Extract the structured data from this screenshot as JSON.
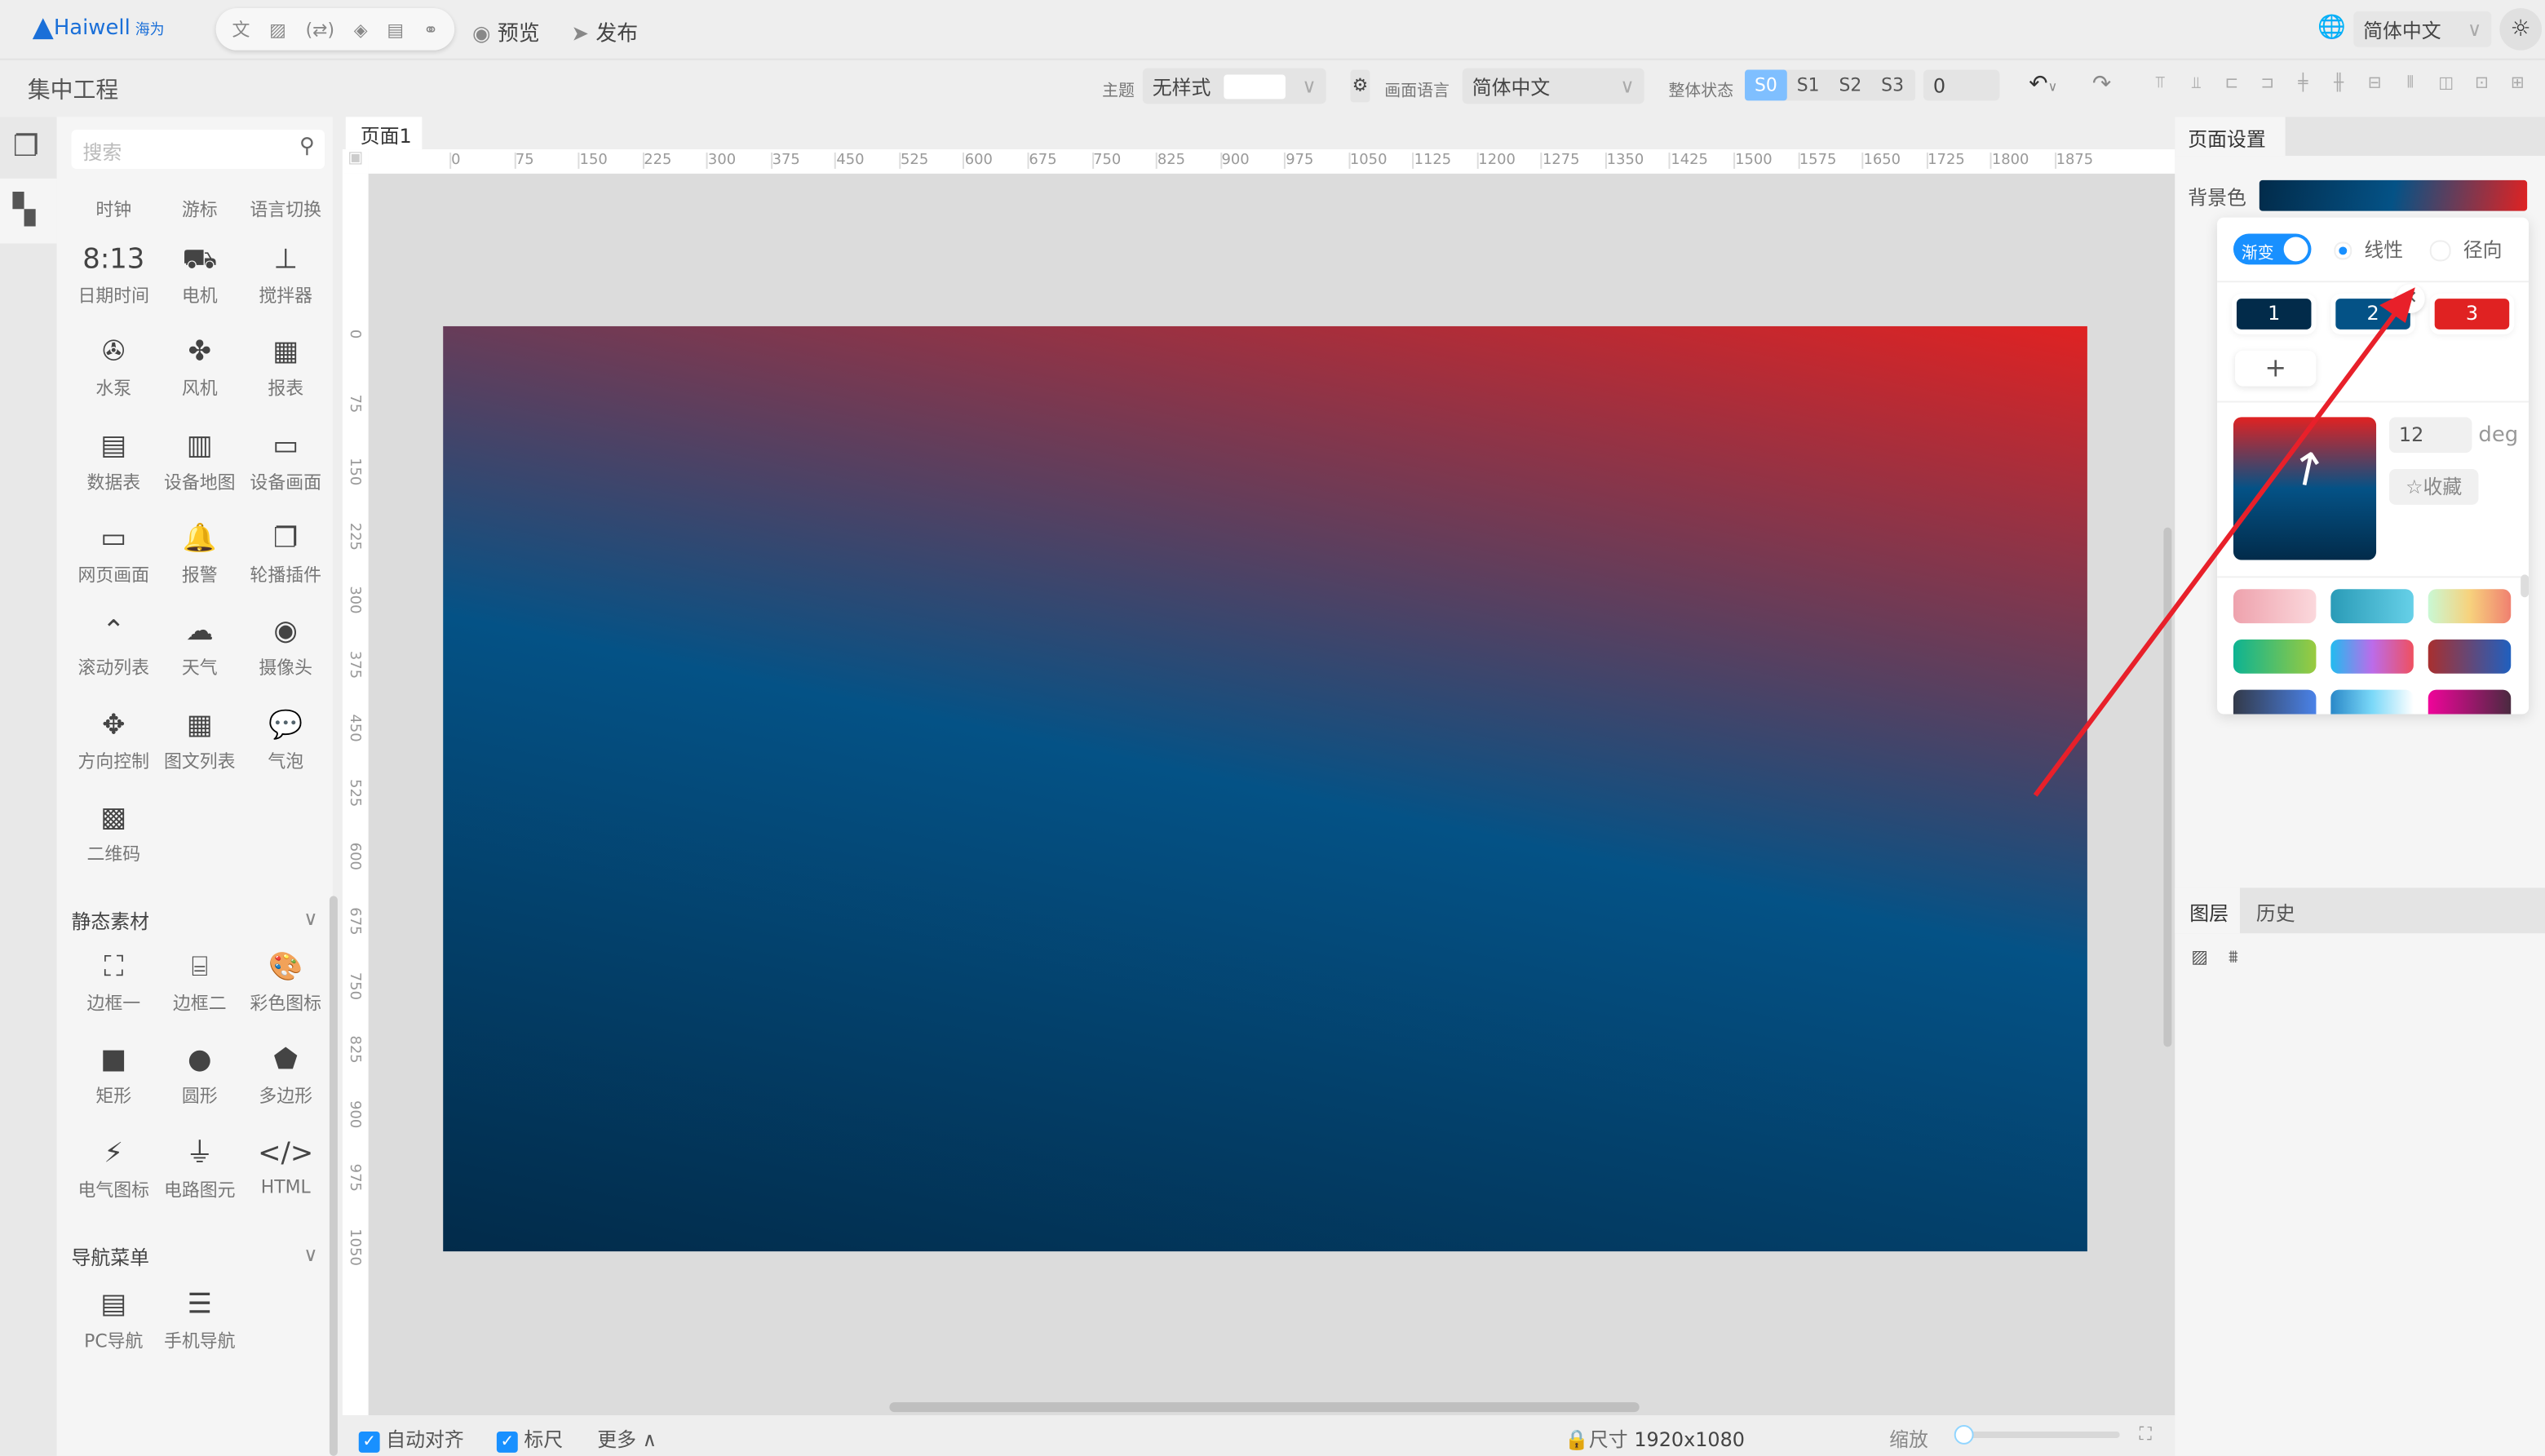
{
  "app": {
    "logo_text": "Haiwell",
    "logo_cn": "海为",
    "preview": "预览",
    "publish": "发布",
    "language": "简体中文",
    "toolbar_icons": [
      "translate-icon",
      "image-icon",
      "variable-icon",
      "layers-icon",
      "document-icon",
      "link-icon"
    ]
  },
  "project": {
    "title": "集中工程"
  },
  "controls": {
    "theme_label": "主题",
    "theme_value": "无样式",
    "lang_label": "画面语言",
    "lang_value": "简体中文",
    "state_label": "整体状态",
    "states": [
      "S0",
      "S1",
      "S2",
      "S3"
    ],
    "active_state": "S0",
    "state_input": "0"
  },
  "left": {
    "search_placeholder": "搜索",
    "tabs": [
      "时钟",
      "游标",
      "语言切换"
    ],
    "components": [
      {
        "icon": "8:13",
        "label": "日期时间"
      },
      {
        "icon": "⛟",
        "label": "电机"
      },
      {
        "icon": "⊥",
        "label": "搅拌器"
      },
      {
        "icon": "✇",
        "label": "水泵"
      },
      {
        "icon": "✤",
        "label": "风机"
      },
      {
        "icon": "▦",
        "label": "报表"
      },
      {
        "icon": "▤",
        "label": "数据表"
      },
      {
        "icon": "▥",
        "label": "设备地图"
      },
      {
        "icon": "▭",
        "label": "设备画面"
      },
      {
        "icon": "▭",
        "label": "网页画面"
      },
      {
        "icon": "🔔",
        "label": "报警"
      },
      {
        "icon": "❐",
        "label": "轮播插件"
      },
      {
        "icon": "⌃",
        "label": "滚动列表"
      },
      {
        "icon": "☁",
        "label": "天气"
      },
      {
        "icon": "◉",
        "label": "摄像头"
      },
      {
        "icon": "✥",
        "label": "方向控制"
      },
      {
        "icon": "▦",
        "label": "图文列表"
      },
      {
        "icon": "💬",
        "label": "气泡"
      },
      {
        "icon": "▩",
        "label": "二维码"
      }
    ],
    "static_section": "静态素材",
    "static": [
      {
        "icon": "⛶",
        "label": "边框一"
      },
      {
        "icon": "⌸",
        "label": "边框二"
      },
      {
        "icon": "🎨",
        "label": "彩色图标"
      },
      {
        "icon": "■",
        "label": "矩形"
      },
      {
        "icon": "●",
        "label": "圆形"
      },
      {
        "icon": "⬟",
        "label": "多边形"
      },
      {
        "icon": "⚡",
        "label": "电气图标"
      },
      {
        "icon": "⏚",
        "label": "电路图元"
      },
      {
        "icon": "</>",
        "label": "HTML"
      }
    ],
    "nav_section": "导航菜单",
    "nav": [
      {
        "icon": "▤",
        "label": "PC导航"
      },
      {
        "icon": "☰",
        "label": "手机导航"
      }
    ]
  },
  "canvas": {
    "page_tab": "页面1",
    "h_ticks": [
      "0",
      "75",
      "150",
      "225",
      "300",
      "375",
      "450",
      "525",
      "600",
      "675",
      "750",
      "825",
      "900",
      "975",
      "1050",
      "1125",
      "1200",
      "1275",
      "1350",
      "1425",
      "1500",
      "1575",
      "1650",
      "1725",
      "1800",
      "1875"
    ],
    "v_ticks": [
      "0",
      "75",
      "150",
      "225",
      "300",
      "375",
      "450",
      "525",
      "600",
      "675",
      "750",
      "825",
      "900",
      "975",
      "1050"
    ]
  },
  "bottom": {
    "auto_align": "自动对齐",
    "ruler": "标尺",
    "more": "更多",
    "size_label": "尺寸",
    "size_value": "1920x1080",
    "zoom_label": "缩放",
    "zoom_value": 0
  },
  "right": {
    "tab": "页面设置",
    "bg_label": "背景色",
    "gradient_toggle": "渐变",
    "gradient_on": true,
    "linear": "线性",
    "radial": "径向",
    "type_selected": "线性",
    "stops": [
      {
        "label": "1",
        "color": "#022b4a"
      },
      {
        "label": "2",
        "color": "#045286"
      },
      {
        "label": "3",
        "color": "#e02222"
      }
    ],
    "angle": "12",
    "angle_unit": "deg",
    "favorite": "收藏",
    "presets": [
      [
        "#eea2ad",
        "#fbd8dc"
      ],
      [
        "#2a9bb7",
        "#66d0e8"
      ],
      [
        "#c9f8d4",
        "#f7d27d",
        "#f08070"
      ],
      [
        "#0db392",
        "#9acb3f"
      ],
      [
        "#22bbef",
        "#bb6cea",
        "#ef5060"
      ],
      [
        "#a82f2f",
        "#2060bf"
      ],
      [
        "#333a4a",
        "#4a82e8"
      ],
      [
        "#2a88c8",
        "#7ad8f8",
        "#ffffff"
      ],
      [
        "#f0049a",
        "#4a2a40"
      ]
    ],
    "layers_tab": "图层",
    "history_tab": "历史"
  }
}
